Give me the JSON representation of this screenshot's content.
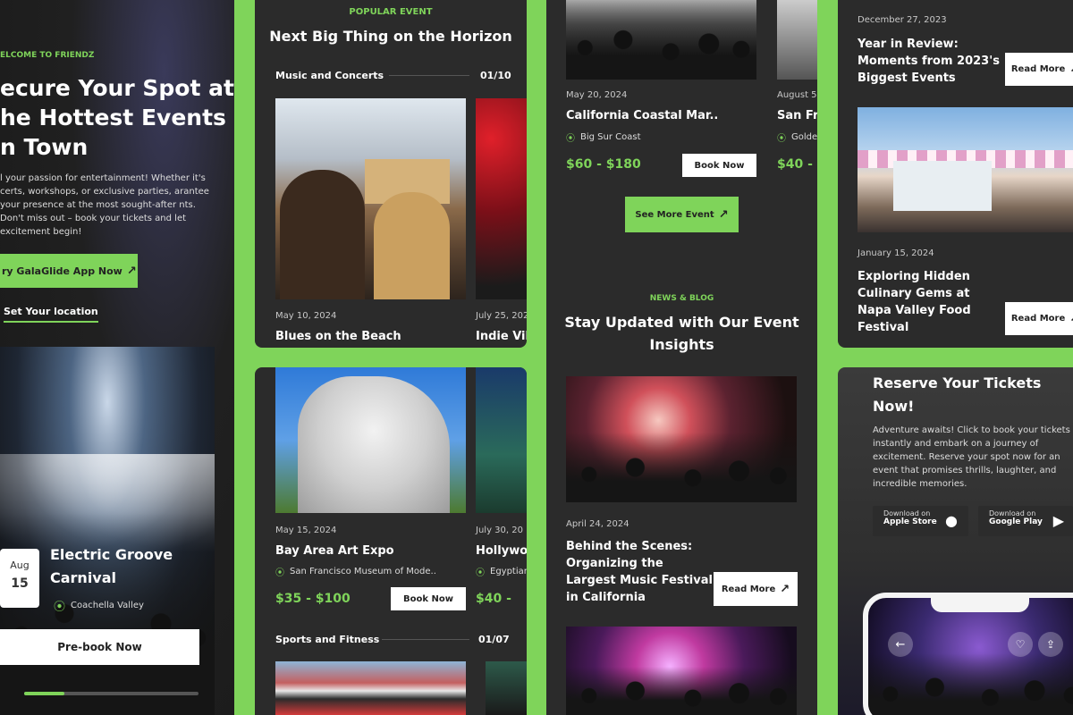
{
  "hero": {
    "eyebrow": "ELCOME TO FRIENDZ",
    "heading_l1": "ecure Your Spot at",
    "heading_l2": "he Hottest Events",
    "heading_l3": "n Town",
    "body": "l your passion for entertainment! Whether it's certs, workshops, or exclusive parties, arantee your presence at the most sought-after nts. Don't miss out – book your tickets and let excitement begin!",
    "cta": "ry GalaGlide App Now",
    "location_link": "Set Your location",
    "feature": {
      "month": "Aug",
      "day": "15",
      "title_l1": "Electric Groove",
      "title_l2": "Carnival",
      "location": "Coachella Valley",
      "prebook": "Pre-book Now"
    }
  },
  "popular": {
    "eyebrow": "POPULAR EVENT",
    "title": "Next Big Thing on the Horizon",
    "category": "Music and Concerts",
    "counter": "01/10",
    "card1": {
      "date": "May 10, 2024",
      "title": "Blues on the Beach"
    },
    "card2": {
      "date": "July 25, 202",
      "title": "Indie Vib"
    }
  },
  "expo": {
    "card1": {
      "date": "May 15, 2024",
      "title": "Bay Area Art Expo",
      "location": "San Francisco Museum of Mode..",
      "price": "$35 - $100",
      "book": "Book Now"
    },
    "card2": {
      "date": "July 30, 20",
      "title": "Hollywoo",
      "location": "Egyptian",
      "price": "$40 -"
    },
    "category": "Sports and Fitness",
    "counter": "01/07"
  },
  "coastal": {
    "card1": {
      "date": "May 20, 2024",
      "title": "California Coastal Mar..",
      "location": "Big Sur Coast",
      "price": "$60 - $180",
      "book": "Book Now"
    },
    "card2": {
      "date": "August 5",
      "title": "San Fra",
      "location": "Golde",
      "price": "$40 -"
    },
    "see_more": "See More Event"
  },
  "news": {
    "eyebrow": "NEWS & BLOG",
    "title_l1": "Stay Updated with Our Event",
    "title_l2": "Insights",
    "post_date": "April 24, 2024",
    "post_l1": "Behind the Scenes:",
    "post_l2": "Organizing the",
    "post_l3": "Largest Music Festival",
    "post_l4": "in California",
    "read_more": "Read More"
  },
  "blog": {
    "top_date": "December 27, 2023",
    "top_l1": "Year in Review:",
    "top_l2": "Moments from 2023's",
    "top_l3": "Biggest Events",
    "read_more": "Read More",
    "second_date": "January 15, 2024",
    "second_l1": "Exploring Hidden",
    "second_l2": "Culinary Gems at",
    "second_l3": "Napa Valley Food",
    "second_l4": "Festival"
  },
  "reserve": {
    "title_l1": "Reserve Your Tickets",
    "title_l2": "Now!",
    "body": "Adventure awaits! Click to book your tickets instantly and embark on a journey of excitement. Reserve your spot now for an event that promises thrills, laughter, and incredible memories.",
    "apple_small": "Download on",
    "apple_big": "Apple Store",
    "google_small": "Download on",
    "google_big": "Google Play"
  },
  "colors": {
    "accent": "#7fd45a",
    "panel": "#2b2b2b",
    "dark": "#1c1c1c"
  }
}
